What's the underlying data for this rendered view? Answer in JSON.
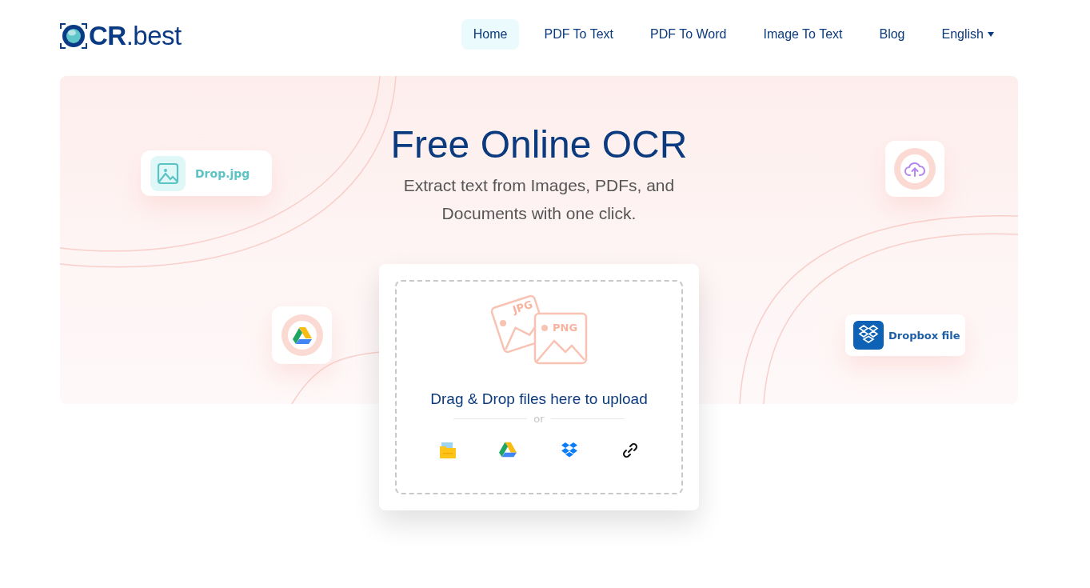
{
  "logo": {
    "text": "CR",
    "suffix": ".best"
  },
  "nav": [
    {
      "label": "Home",
      "selected": true
    },
    {
      "label": "PDF To Text",
      "selected": false
    },
    {
      "label": "PDF To Word",
      "selected": false
    },
    {
      "label": "Image To Text",
      "selected": false
    },
    {
      "label": "Blog",
      "selected": false
    },
    {
      "label": "English",
      "kind": "dropdown",
      "selected": false
    }
  ],
  "hero": {
    "title": "Free Online OCR",
    "subtitle": "Extract text from Images, PDFs, and Documents with one click."
  },
  "floating_cards": [
    {
      "kind": "image",
      "label": "Drop.jpg"
    },
    {
      "kind": "drive"
    },
    {
      "kind": "cloud"
    },
    {
      "kind": "dropbox",
      "label": "Dropbox file"
    }
  ],
  "upload": {
    "illustration_labels": [
      "JPG",
      "PNG"
    ],
    "prompt": "Drag & Drop files here to upload",
    "separator": "or",
    "sources": [
      {
        "kind": "folder"
      },
      {
        "kind": "drive"
      },
      {
        "kind": "dropbox"
      },
      {
        "kind": "link"
      }
    ]
  }
}
